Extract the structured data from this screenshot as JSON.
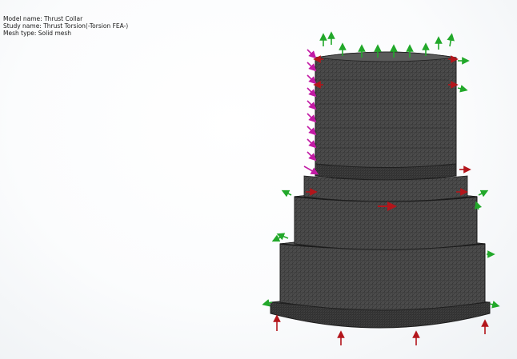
{
  "study_info": {
    "model_name": "Model name: Thrust Collar",
    "study_name": "Study name: Thrust Torsion(-Torsion FEA-)",
    "mesh_type": "Mesh type: Solid mesh"
  },
  "colors": {
    "mesh_fill": "#4b4b4b",
    "mesh_lines": "#2a2a2a",
    "fixture_arrow": "#22a82a",
    "torque_arrow": "#c21aa4",
    "force_arrow": "#b3151b"
  },
  "icons": {
    "fixture": "green-fixture-arrow-icon",
    "torque": "magenta-torque-arrow-icon",
    "force": "red-force-arrow-icon"
  }
}
